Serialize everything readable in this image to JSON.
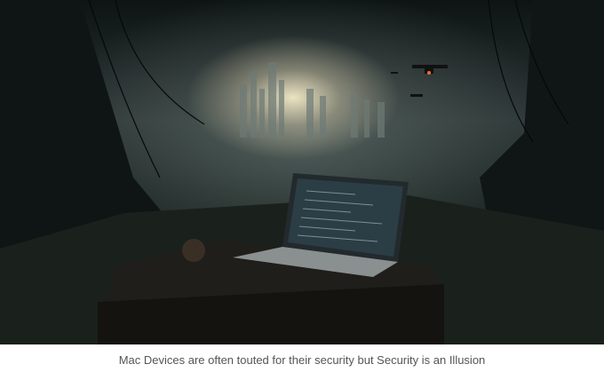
{
  "figure": {
    "image_alt_icon": "dystopian-laptop-illustration",
    "caption": "Mac Devices are often touted for their security but Security is an Illusion"
  }
}
